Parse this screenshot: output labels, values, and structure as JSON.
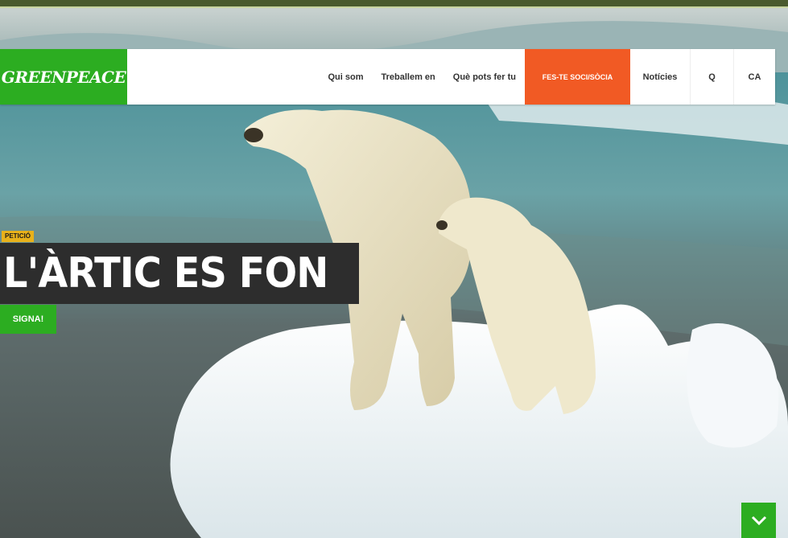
{
  "brand": {
    "logo_text": "GREENPEACE",
    "color": "#2cad21"
  },
  "nav": {
    "items": [
      {
        "label": "Qui som"
      },
      {
        "label": "Treballem en"
      },
      {
        "label": "Què pots fer tu"
      }
    ],
    "cta_label": "FES-TE SOCI/SÒCIA",
    "cta_color": "#f15a24",
    "news_label": "Notícies",
    "search_label": "Q",
    "lang_label": "CA"
  },
  "hero": {
    "tag": "PETICIÓ",
    "headline": "L'ÀRTIC ES FON",
    "button_label": "SIGNA!"
  },
  "icons": {
    "scroll": "chevron-down-icon"
  }
}
